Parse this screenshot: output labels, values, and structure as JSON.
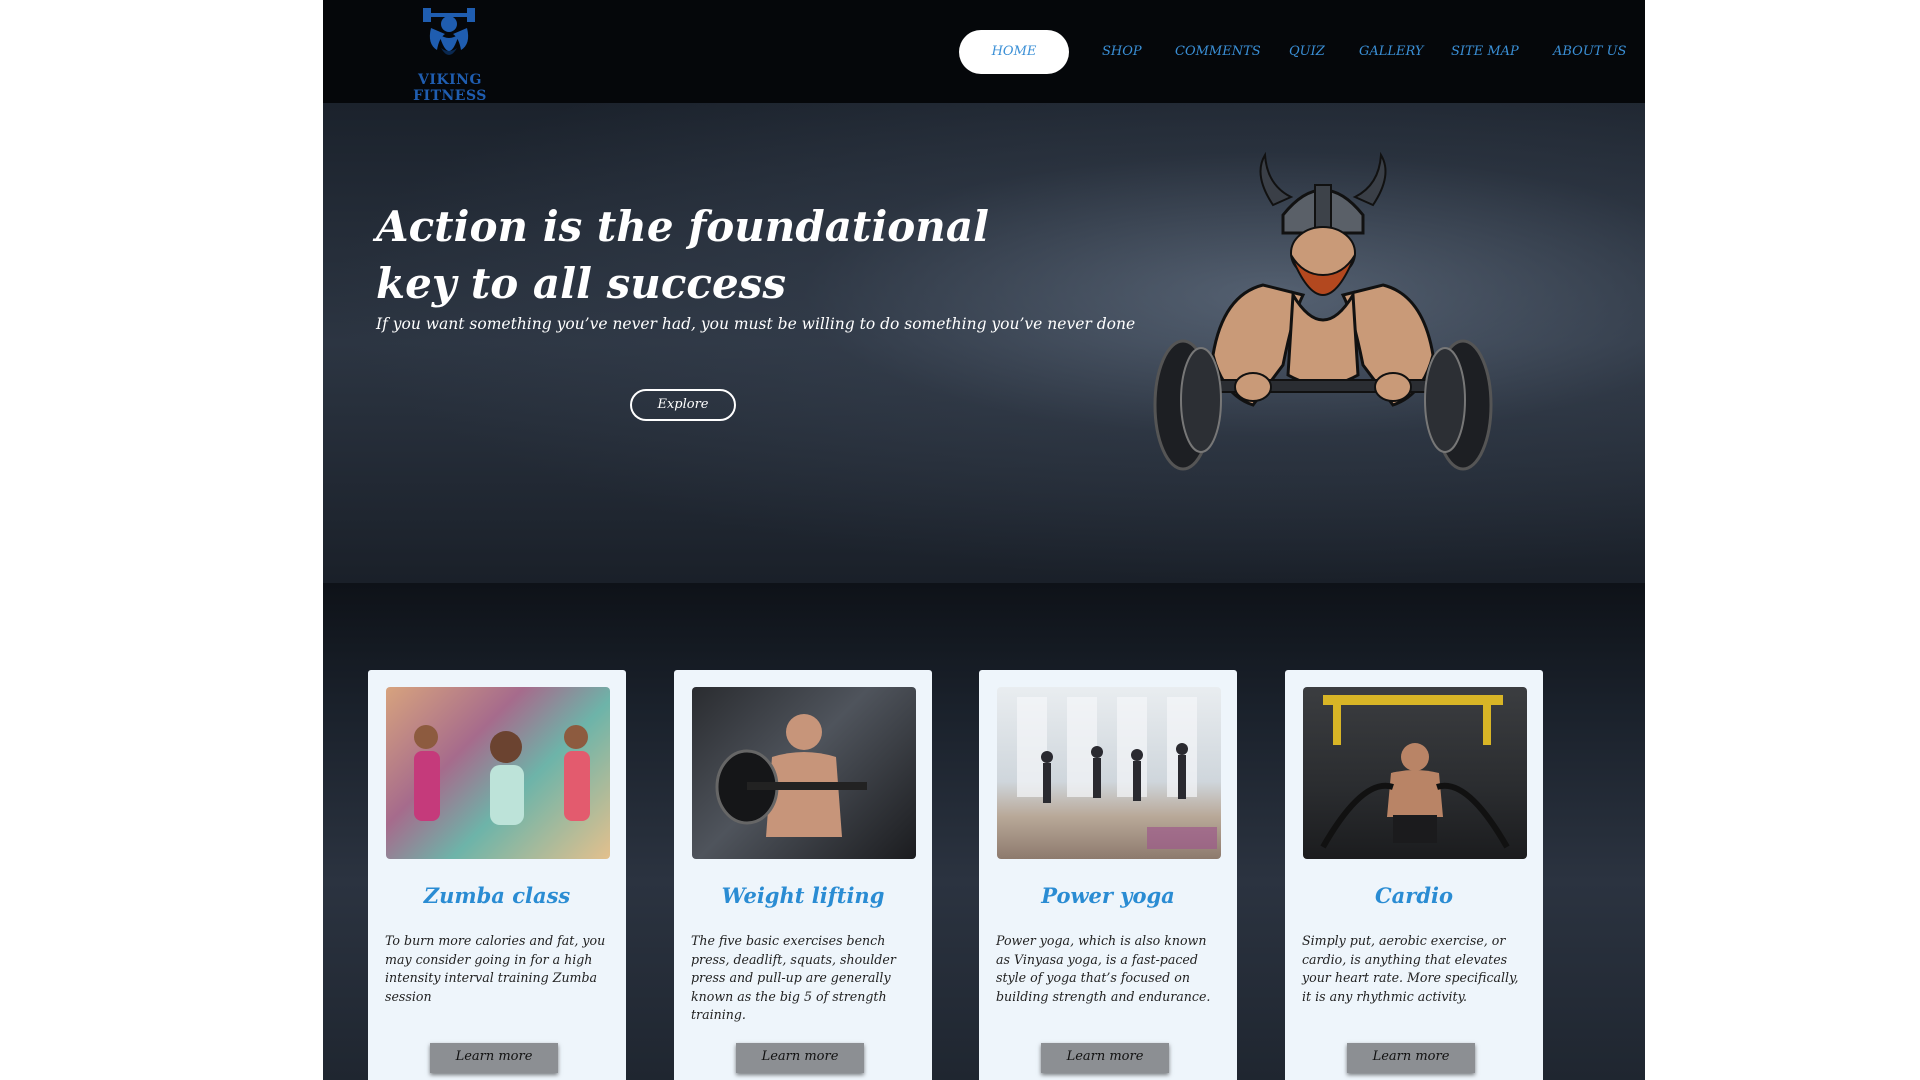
{
  "brand": {
    "logo_text": "VIKING FITNESS",
    "accent_color": "#3a8fd6",
    "logo_color": "#1f5db0"
  },
  "nav": {
    "items": [
      {
        "label": "HOME",
        "active": true
      },
      {
        "label": "SHOP",
        "active": false
      },
      {
        "label": "COMMENTS",
        "active": false
      },
      {
        "label": "QUIZ",
        "active": false
      },
      {
        "label": "GALLERY",
        "active": false
      },
      {
        "label": "SITE MAP",
        "active": false
      },
      {
        "label": "ABOUT US",
        "active": false
      }
    ]
  },
  "hero": {
    "title": "Action is the foundational key to all success",
    "subtitle": "If you want something you’ve never had, you must be willing to do something you’ve never done",
    "button_label": "Explore",
    "mascot_icon": "viking-weightlifter-mascot"
  },
  "cards": [
    {
      "title": "Zumba class",
      "text": "To burn more calories and fat, you may consider going in for a high intensity interval training Zumba session",
      "button_label": "Learn more",
      "image": "zumba-class-photo"
    },
    {
      "title": "Weight lifting",
      "text": "The five basic exercises bench press, deadlift, squats, shoulder press and pull-up are generally known as the big 5 of strength training.",
      "button_label": "Learn more",
      "image": "weight-lifting-photo"
    },
    {
      "title": "Power yoga",
      "text": "Power yoga, which is also known as Vinyasa yoga, is a fast-paced style of yoga that’s focused on building strength and endurance.",
      "button_label": "Learn more",
      "image": "power-yoga-photo"
    },
    {
      "title": "Cardio",
      "text": "Simply put, aerobic exercise, or cardio, is anything that elevates your heart rate. More specifically, it is any rhythmic activity.",
      "button_label": "Learn more",
      "image": "cardio-photo"
    }
  ]
}
